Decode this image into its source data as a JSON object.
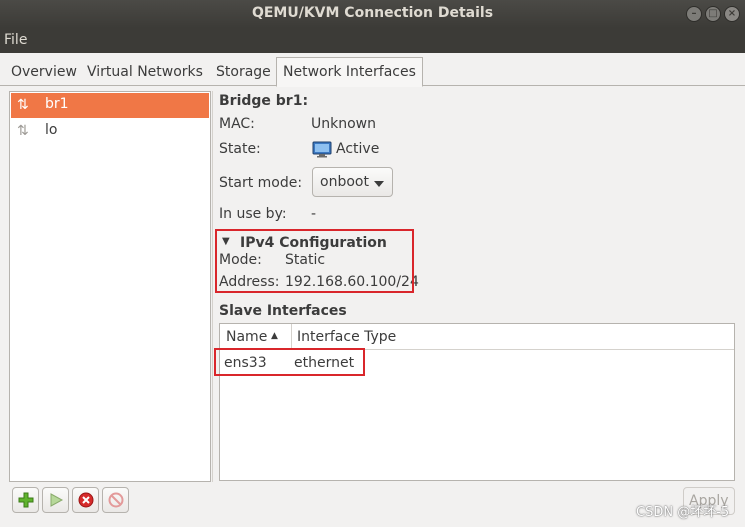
{
  "window": {
    "title": "QEMU/KVM Connection Details"
  },
  "menu": {
    "file": "File"
  },
  "tabs": [
    {
      "label": "Overview"
    },
    {
      "label": "Virtual Networks"
    },
    {
      "label": "Storage"
    },
    {
      "label": "Network Interfaces",
      "active": true
    }
  ],
  "interfaces": [
    {
      "name": "br1",
      "selected": true,
      "icon": "network-arrows-icon"
    },
    {
      "name": "lo",
      "selected": false,
      "icon": "network-arrows-icon"
    }
  ],
  "details": {
    "heading": "Bridge br1:",
    "mac_label": "MAC:",
    "mac_value": "Unknown",
    "state_label": "State:",
    "state_value": "Active",
    "start_mode_label": "Start mode:",
    "start_mode_value": "onboot",
    "in_use_label": "In use by:",
    "in_use_value": "-"
  },
  "ipv4": {
    "heading": "IPv4 Configuration",
    "mode_label": "Mode:",
    "mode_value": "Static",
    "address_label": "Address:",
    "address_value": "192.168.60.100/24"
  },
  "slave": {
    "heading": "Slave Interfaces",
    "columns": [
      "Name",
      "Interface Type"
    ],
    "rows": [
      {
        "name": "ens33",
        "type": "ethernet"
      }
    ]
  },
  "buttons": {
    "apply": "Apply"
  },
  "watermark": "CSDN @坏坏-5",
  "colors": {
    "selection": "#f07746",
    "highlight_box": "#d9262b",
    "titlebar": "#3c3b37"
  }
}
